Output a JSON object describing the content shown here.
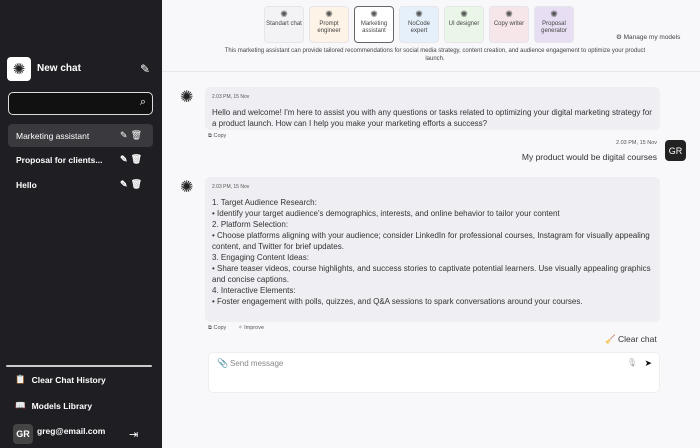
{
  "sidebar": {
    "new_chat": "New chat",
    "search_placeholder": "",
    "chats": [
      {
        "label": "Marketing assistant"
      },
      {
        "label": "Proposal for clients..."
      },
      {
        "label": "Hello"
      }
    ],
    "clear_history": "Clear Chat History",
    "models_library": "Models Library",
    "user": {
      "initials": "GR",
      "email": "greg@email.com"
    }
  },
  "models": [
    {
      "label": "Standart chat",
      "color": "#f3f2f5"
    },
    {
      "label": "Prompt engineer",
      "color": "#fdf3e6"
    },
    {
      "label": "Marketing assistant",
      "color": "#ffffff"
    },
    {
      "label": "NoCode expert",
      "color": "#e6f0fb"
    },
    {
      "label": "UI designer",
      "color": "#eaf6e8"
    },
    {
      "label": "Copy writer",
      "color": "#f6e6ea"
    },
    {
      "label": "Proposal generator",
      "color": "#e7def3"
    }
  ],
  "manage_models": "Manage my models",
  "description": "This marketing assistant can provide tailored recommendations for social media strategy, content creation, and audience engagement to optimize your product launch.",
  "messages": {
    "bot1": {
      "time": "2.03 PM, 15 Nov",
      "text": "Hello and welcome!  I'm here to assist you with any questions or tasks related to optimizing your digital marketing strategy for a product launch. How can I help you make your marketing efforts a success?",
      "copy": "Copy"
    },
    "user1": {
      "time": "2.03 PM, 15 Nov",
      "text": "My product would be digital courses",
      "initials": "GR"
    },
    "bot2": {
      "time": "2.03 PM, 15 Nov",
      "lines": [
        "1. Target Audience Research:",
        "• Identify your target audience's demographics, interests, and online behavior to tailor your content",
        "2. Platform Selection:",
        "• Choose platforms aligning with your audience; consider LinkedIn for professional courses, Instagram for visually appealing content, and Twitter for brief updates.",
        "3. Engaging Content Ideas:",
        "• Share teaser videos, course highlights, and success stories to captivate potential learners. Use visually appealing graphics and concise captions.",
        "4. Interactive Elements:",
        "• Foster engagement with polls, quizzes, and Q&A sessions to spark conversations around your courses."
      ],
      "copy": "Copy",
      "improve": "Improve"
    }
  },
  "clear_chat": "Clear chat",
  "input": {
    "placeholder": "Send message",
    "value": ""
  }
}
